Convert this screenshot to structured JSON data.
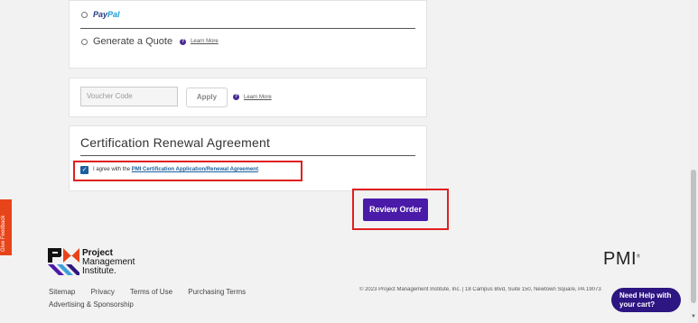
{
  "payment": {
    "paypal_label_a": "Pay",
    "paypal_label_b": "Pal",
    "quote_label": "Generate a Quote",
    "quote_help": "?",
    "quote_learn_more": "Learn More"
  },
  "voucher": {
    "placeholder": "Voucher Code",
    "apply_label": "Apply",
    "help": "?",
    "learn_more": "Learn More"
  },
  "certification": {
    "title": "Certification Renewal Agreement",
    "agree_prefix": "I agree with the ",
    "agree_link": "PMI Certification Application/Renewal Agreement",
    "agree_suffix": ".",
    "checkmark": "✓"
  },
  "review_order_label": "Review Order",
  "feedback_label": "Give Feedback",
  "footer": {
    "logo_line1": "Project",
    "logo_line2": "Management",
    "logo_line3": "Institute.",
    "pmi_mark": "PMI",
    "pmi_reg": "®",
    "links": [
      "Sitemap",
      "Privacy",
      "Terms of Use",
      "Purchasing Terms"
    ],
    "links2": "Advertising & Sponsorship",
    "copyright": "© 2023 Project Management Institute, Inc.   |   18 Campus Blvd, Suite 150, Newtown Square, PA 19073"
  },
  "help_bubble": {
    "line1": "Need Help with",
    "line2": "your cart?"
  },
  "scroll_down": "▼",
  "colors": {
    "accent": "#4a1aa8",
    "highlight_border": "#e02020",
    "feedback": "#e8441a",
    "link": "#1a5f9e"
  }
}
